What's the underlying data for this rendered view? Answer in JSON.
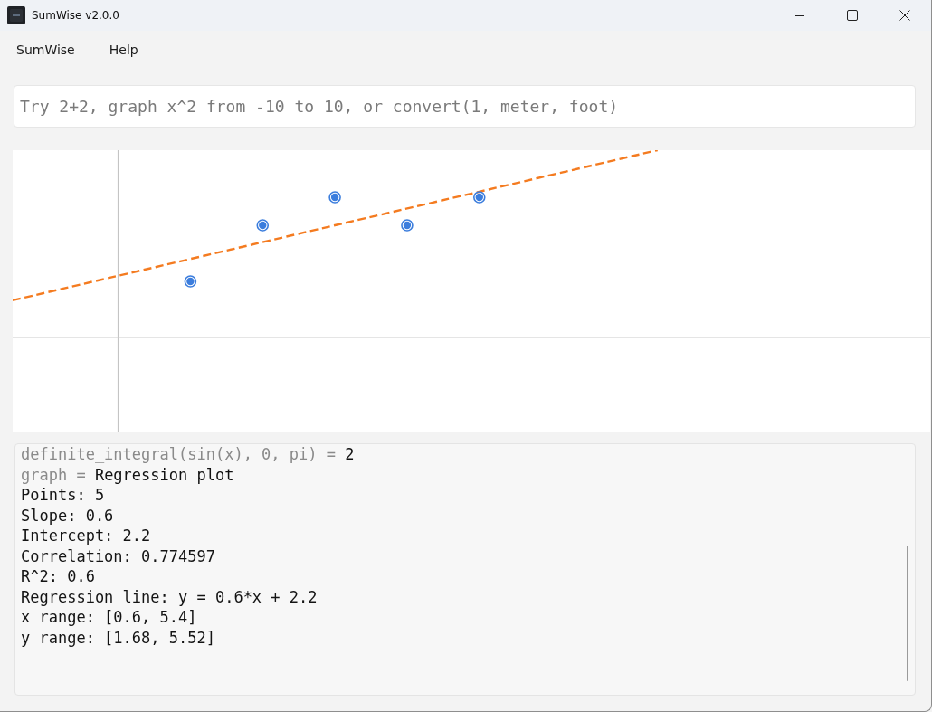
{
  "window": {
    "title": "SumWise v2.0.0"
  },
  "menu": [
    {
      "label": "SumWise"
    },
    {
      "label": "Help"
    }
  ],
  "input": {
    "placeholder": "Try 2+2, graph x^2 from -10 to 10, or convert(1, meter, foot)"
  },
  "output": {
    "lines": [
      {
        "kind": "result",
        "expression": "definite_integral(sin(x), 0, pi) =",
        "value": "2"
      },
      {
        "kind": "result",
        "expression": "graph =",
        "value": "Regression plot"
      },
      {
        "kind": "text",
        "text": "Points: 5"
      },
      {
        "kind": "text",
        "text": "Slope: 0.6"
      },
      {
        "kind": "text",
        "text": "Intercept: 2.2"
      },
      {
        "kind": "text",
        "text": "Correlation: 0.774597"
      },
      {
        "kind": "text",
        "text": "R^2: 0.6"
      },
      {
        "kind": "text",
        "text": "Regression line: y = 0.6*x + 2.2"
      },
      {
        "kind": "text",
        "text": "x range: [0.6, 5.4]"
      },
      {
        "kind": "text",
        "text": "y range: [1.68, 5.52]"
      }
    ]
  }
}
